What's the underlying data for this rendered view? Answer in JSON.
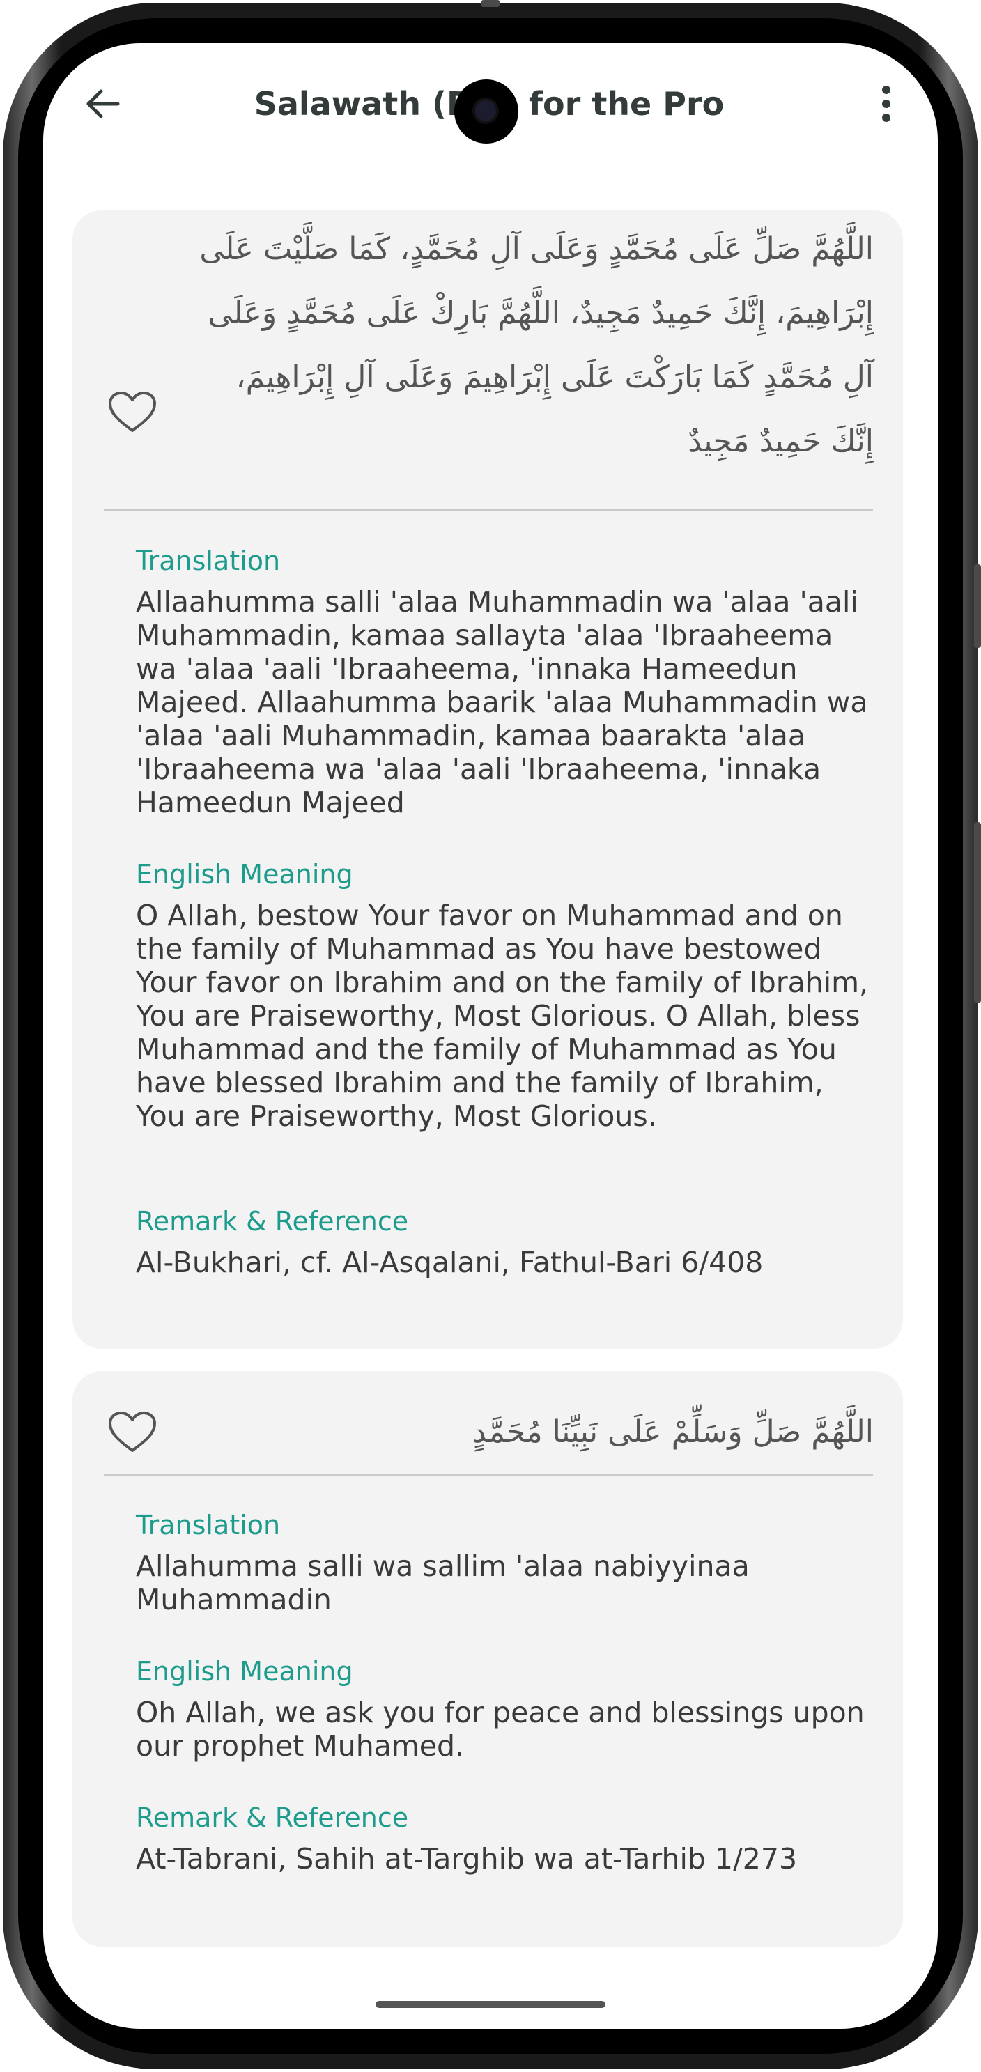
{
  "app_bar": {
    "title": "Salawath (Dua for the Pro",
    "back_icon": "arrow-left-icon",
    "menu_icon": "more-vertical-icon"
  },
  "colors": {
    "accent": "#1d9c8e",
    "card_bg": "#f4f3f3",
    "text": "#3a3a3a",
    "arabic_text": "#555555"
  },
  "cards": [
    {
      "favorite_icon": "heart-outline-icon",
      "arabic": "اللَّهُمَّ صَلِّ عَلَى مُحَمَّدٍ وَعَلَى آلِ مُحَمَّدٍ، كَمَا صَلَّيْتَ عَلَى إِبْرَاهِيمَ، إِنَّكَ حَمِيدٌ مَجِيدٌ، اللَّهُمَّ بَارِكْ عَلَى مُحَمَّدٍ وَعَلَى آلِ مُحَمَّدٍ كَمَا بَارَكْتَ عَلَى إِبْرَاهِيمَ وَعَلَى آلِ إِبْرَاهِيمَ، إِنَّكَ حَمِيدٌ مَجِيدٌ",
      "translation_label": "Translation",
      "translation": "Allaahumma salli 'alaa Muhammadin wa 'alaa 'aali Muhammadin, kamaa sallayta 'alaa 'Ibraaheema wa 'alaa 'aali 'Ibraaheema, 'innaka Hameedun Majeed. Allaahumma baarik 'alaa Muhammadin wa 'alaa 'aali Muhammadin, kamaa baarakta 'alaa 'Ibraaheema wa 'alaa 'aali 'Ibraaheema, 'innaka Hameedun Majeed",
      "meaning_label": "English Meaning",
      "meaning": "O Allah, bestow Your favor on Muhammad and on the family of Muhammad as You have bestowed Your favor on Ibrahim and on the family of Ibrahim, You are Praiseworthy, Most Glorious. O Allah, bless Muhammad and the family of Muhammad as You have blessed Ibrahim and the family of Ibrahim, You are Praiseworthy, Most Glorious.",
      "reference_label": "Remark & Reference",
      "reference": "Al-Bukhari, cf. Al-Asqalani, Fathul-Bari 6/408"
    },
    {
      "favorite_icon": "heart-outline-icon",
      "arabic": "اللَّهُمَّ صَلِّ وَسَلِّمْ عَلَى نَبِيِّنَا مُحَمَّدٍ",
      "translation_label": "Translation",
      "translation": "Allahumma salli wa sallim 'alaa nabiyyinaa Muhammadin",
      "meaning_label": "English Meaning",
      "meaning": "Oh Allah, we ask you for peace and blessings upon our prophet Muhamed.",
      "reference_label": "Remark & Reference",
      "reference": "At-Tabrani, Sahih at-Targhib wa at-Tarhib 1/273"
    }
  ]
}
